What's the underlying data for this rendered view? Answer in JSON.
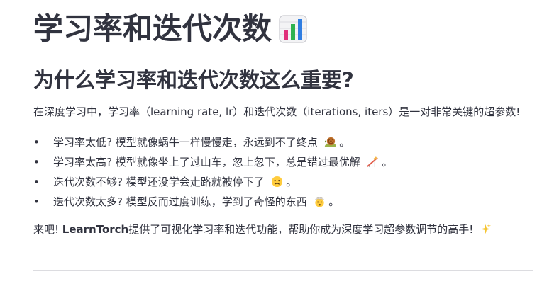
{
  "page": {
    "title": "学习率和迭代次数",
    "title_icon": "bar-chart-icon",
    "subtitle": "为什么学习率和迭代次数这么重要?",
    "intro": "在深度学习中，学习率（learning rate, lr）和迭代次数（iterations, iters）是一对非常关键的超参数!",
    "bullets": [
      {
        "text": "学习率太低? 模型就像蜗牛一样慢慢走，永远到不了终点",
        "icon": "snail-icon",
        "tail": "。"
      },
      {
        "text": "学习率太高? 模型就像坐上了过山车，忽上忽下，总是错过最优解",
        "icon": "roller-coaster-icon",
        "tail": "。"
      },
      {
        "text": "迭代次数不够? 模型还没学会走路就被停下了",
        "icon": "worried-face-icon",
        "tail": "。"
      },
      {
        "text": "迭代次数太多? 模型反而过度训练，学到了奇怪的东西",
        "icon": "exploding-head-icon",
        "tail": "。"
      }
    ],
    "outro_prefix": "来吧! ",
    "outro_brand": "LearnTorch",
    "outro_suffix": "提供了可视化学习率和迭代功能，帮助你成为深度学习超参数调节的高手!",
    "outro_icon": "sparkles-icon"
  },
  "colors": {
    "text": "#31333f",
    "divider": "#dcdce0"
  }
}
